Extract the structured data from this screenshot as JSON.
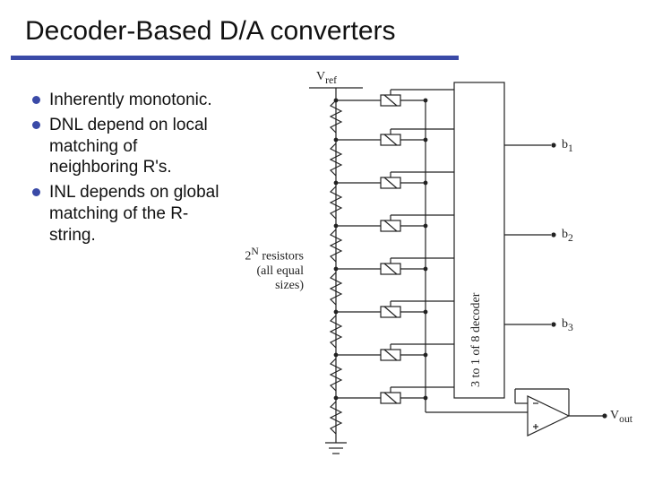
{
  "title": "Decoder-Based D/A converters",
  "bullets": [
    "Inherently monotonic.",
    "DNL depend on local matching of neighboring R's.",
    "INL depends on global matching of the R-string."
  ],
  "diagram": {
    "vref": "Vref",
    "note_top": "2",
    "note_sup": "N",
    "note_rest": " resistors",
    "note_line2": "(all equal sizes)",
    "decoder": "3 to 1 of 8 decoder",
    "b1": "b1",
    "b2": "b2",
    "b3": "b3",
    "bsub1": "1",
    "bsub2": "2",
    "bsub3": "3",
    "vout": "Vout",
    "vout_sub": "out"
  }
}
